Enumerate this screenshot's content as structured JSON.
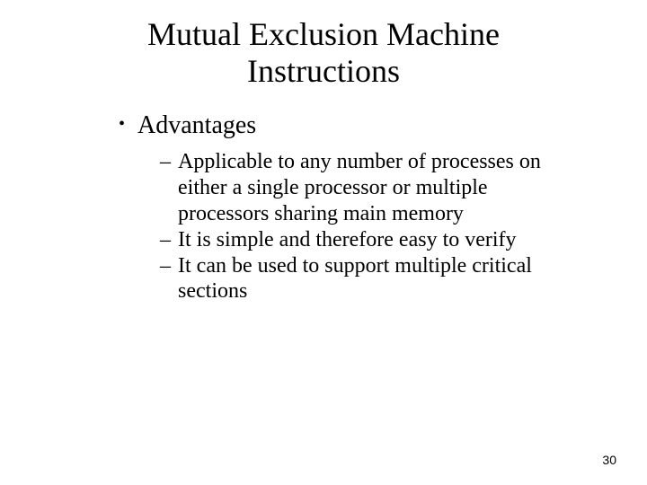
{
  "title": "Mutual Exclusion Machine Instructions",
  "l1": {
    "bullet_glyph": "•",
    "items": [
      {
        "text": "Advantages"
      }
    ]
  },
  "l2": {
    "dash_glyph": "–",
    "items": [
      {
        "text": "Applicable to any number of processes on either a single processor or multiple processors sharing main memory"
      },
      {
        "text": "It is simple and therefore easy to verify"
      },
      {
        "text": "It can be used to support multiple critical sections"
      }
    ]
  },
  "page_number": "30"
}
